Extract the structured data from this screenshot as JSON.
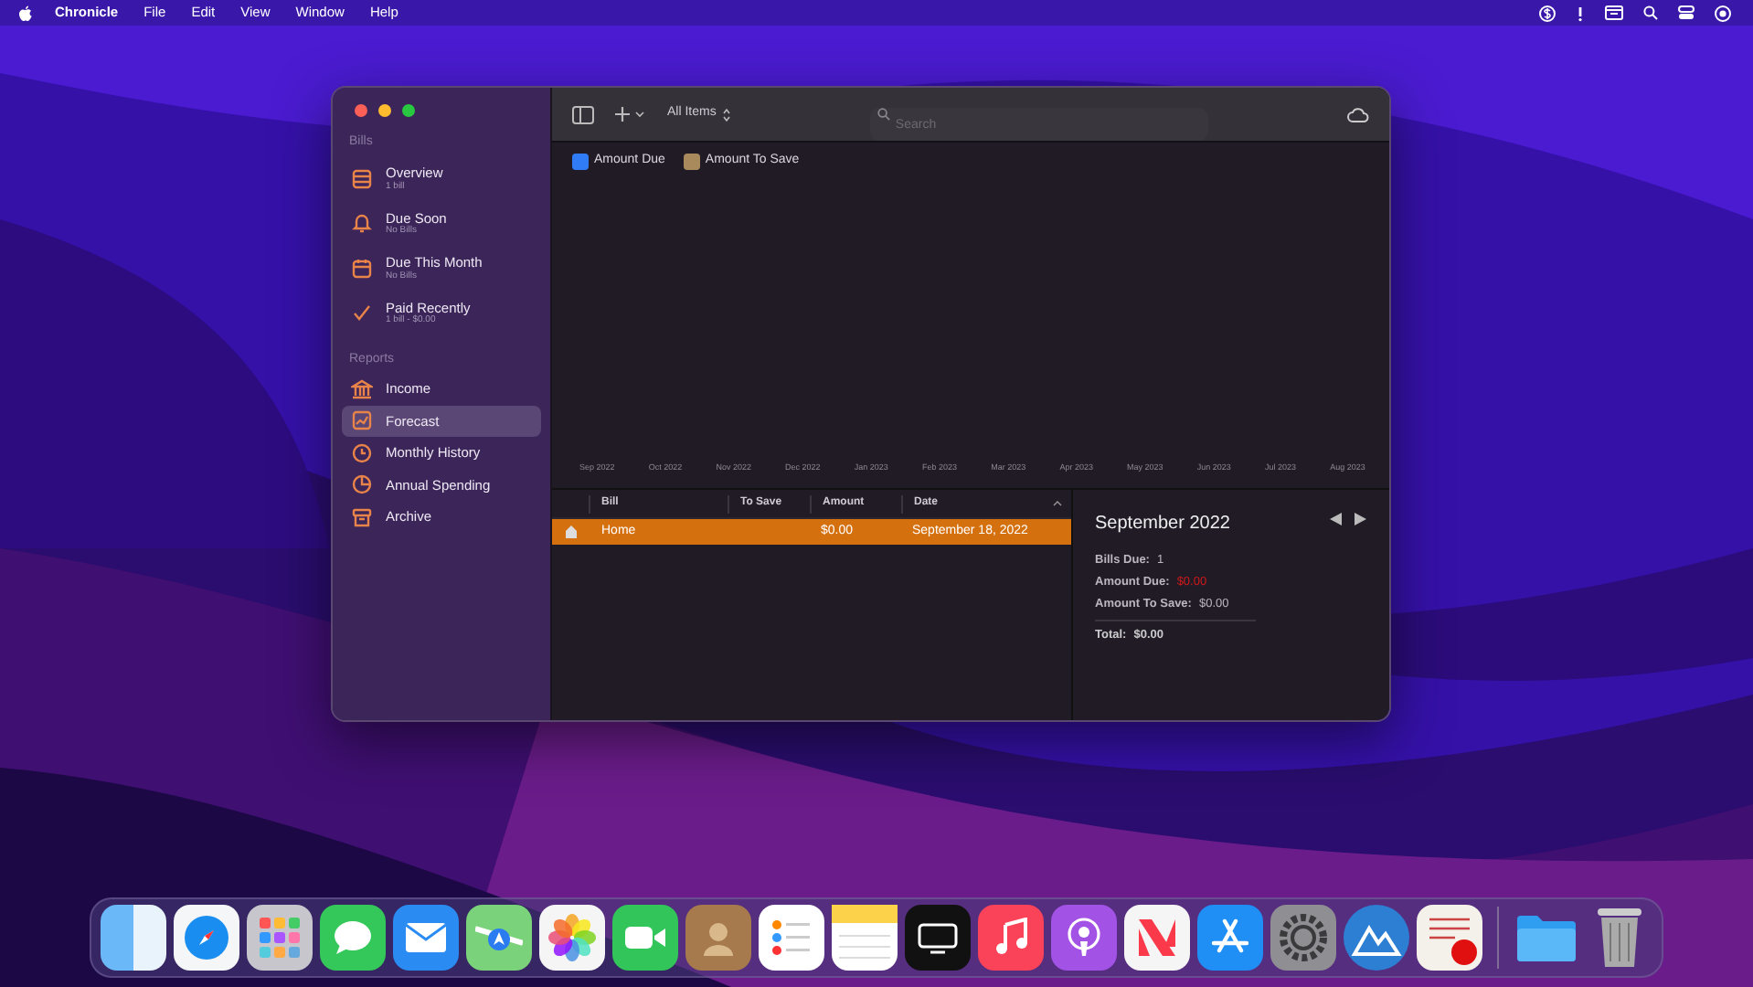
{
  "menu_bar": {
    "items": [
      "Chronicle",
      "File",
      "Edit",
      "View",
      "Window",
      "Help"
    ]
  },
  "sidebar": {
    "sections": [
      {
        "header": "Bills",
        "items": [
          {
            "title": "Overview",
            "subtitle": "1 bill",
            "selected": false
          },
          {
            "title": "Due Soon",
            "subtitle": "No Bills",
            "selected": false
          },
          {
            "title": "Due This Month",
            "subtitle": "No Bills",
            "selected": false
          },
          {
            "title": "Paid Recently",
            "subtitle": "1 bill - $0.00",
            "selected": false
          }
        ]
      },
      {
        "header": "Reports",
        "items": [
          {
            "title": "Income",
            "selected": false
          },
          {
            "title": "Forecast",
            "selected": true
          },
          {
            "title": "Monthly History",
            "selected": false
          },
          {
            "title": "Annual Spending",
            "selected": false
          },
          {
            "title": "Archive",
            "selected": false
          }
        ]
      }
    ]
  },
  "toolbar": {
    "filter": "All Items",
    "search": {
      "placeholder": "Search"
    }
  },
  "chart": {
    "legend": [
      {
        "label": "Amount Due",
        "color": "#2f7cf6"
      },
      {
        "label": "Amount To Save",
        "color": "#a88a5c"
      }
    ],
    "x_labels": [
      "Sep 2022",
      "Oct 2022",
      "Nov 2022",
      "Dec 2022",
      "Jan 2023",
      "Feb 2023",
      "Mar 2023",
      "Apr 2023",
      "May 2023",
      "Jun 2023",
      "Jul 2023",
      "Aug 2023"
    ]
  },
  "table": {
    "columns": [
      "Bill",
      "To Save",
      "Amount",
      "Date"
    ],
    "rows": [
      {
        "bill": "Home",
        "amount": "$0.00",
        "date": "September 18, 2022",
        "selected": true
      }
    ]
  },
  "detail": {
    "title": "September 2022",
    "fields": [
      {
        "label": "Bills Due:",
        "value": "1",
        "kind": "plain"
      },
      {
        "label": "Amount Due:",
        "value": "$0.00",
        "kind": "alert"
      },
      {
        "label": "Amount To Save:",
        "value": "$0.00",
        "kind": "plain"
      }
    ],
    "total": {
      "label": "Total:",
      "value": "$0.00"
    }
  }
}
